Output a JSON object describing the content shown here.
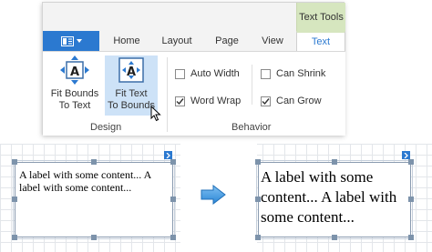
{
  "ribbon": {
    "context_header": "Text Tools",
    "tabs": [
      {
        "label": "Home"
      },
      {
        "label": "Layout"
      },
      {
        "label": "Page"
      },
      {
        "label": "View"
      },
      {
        "label": "Text",
        "active": true
      }
    ],
    "design_group": {
      "label": "Design",
      "buttons": [
        {
          "label": "Fit Bounds\nTo Text",
          "icon": "fit-bounds-icon"
        },
        {
          "label": "Fit Text\nTo Bounds",
          "icon": "fit-text-icon",
          "hovered": true
        }
      ]
    },
    "behavior_group": {
      "label": "Behavior",
      "checkboxes": [
        {
          "label": "Auto Width",
          "checked": false
        },
        {
          "label": "Word Wrap",
          "checked": true
        },
        {
          "label": "Can Shrink",
          "checked": false
        },
        {
          "label": "Can Grow",
          "checked": true
        }
      ]
    },
    "colors": {
      "app_button": "#2b79d0",
      "context_tab": "#d6e6bf",
      "active_tab_text": "#2b79d0",
      "hover": "#cde2f7"
    }
  },
  "surface": {
    "before_label_text": "A label with some content... A label with some content...",
    "after_label_text": "A label with some content... A label with some content...",
    "arrow": "right-arrow-icon"
  }
}
